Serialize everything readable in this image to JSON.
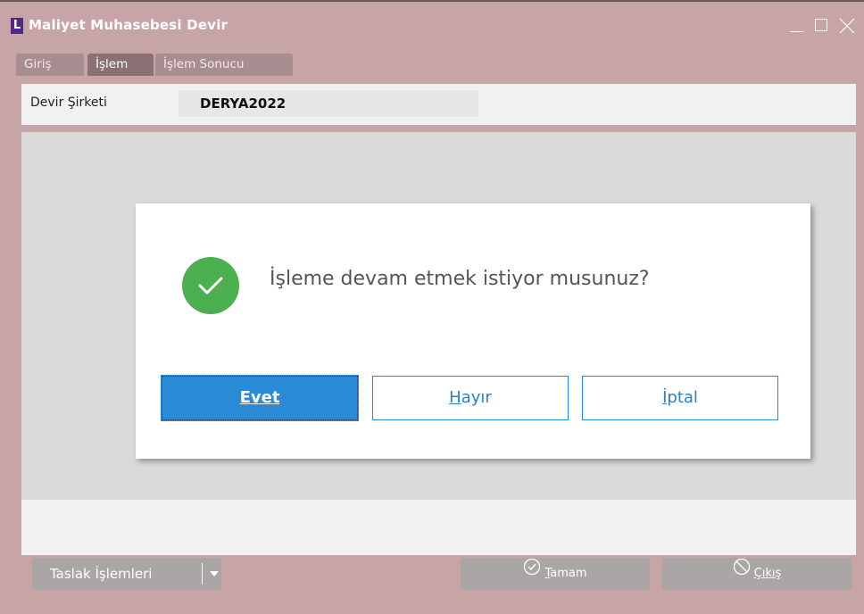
{
  "window": {
    "title": "Maliyet Muhasebesi Devir",
    "logo_letter": "L"
  },
  "tabs": [
    {
      "label": "Giriş",
      "active": false
    },
    {
      "label": "İşlem",
      "active": true
    },
    {
      "label": "İşlem Sonucu",
      "active": false
    }
  ],
  "form": {
    "devir_sirketi_label": "Devir Şirketi",
    "devir_sirketi_value": "DERYA2022"
  },
  "dialog": {
    "question": "İşleme devam etmek istiyor musunuz?",
    "icon": "check-circle-icon",
    "buttons": {
      "evet": {
        "label": "Evet",
        "mnemonic": "E",
        "rest": "vet"
      },
      "hayir": {
        "label": "Hayır",
        "mnemonic": "H",
        "rest": "ayır"
      },
      "iptal": {
        "label": "İptal",
        "mnemonic": "İ",
        "rest": "ptal"
      }
    }
  },
  "footer": {
    "taslak_label": "Taslak İşlemleri",
    "tamam": {
      "label": "Tamam",
      "mnemonic": "T",
      "rest": "amam",
      "icon": "check-outline-icon"
    },
    "cikis": {
      "label": "Çıkış",
      "mnemonic": "Çıkış",
      "icon": "prohibit-icon"
    }
  },
  "colors": {
    "window_bg": "#c7a5a7",
    "tab_bg": "#a88e91",
    "tab_active_bg": "#8a7073",
    "accent_blue": "#2b8ad6",
    "success_green": "#4caf50",
    "footer_btn_bg": "#aaa6a6"
  }
}
